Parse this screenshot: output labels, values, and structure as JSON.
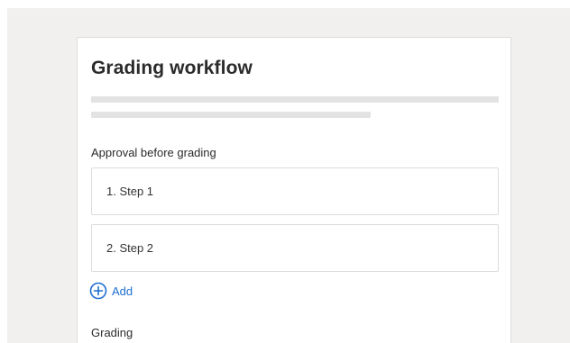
{
  "page": {
    "title": "Grading workflow"
  },
  "approval": {
    "label": "Approval before grading",
    "steps": [
      {
        "label": "1. Step 1"
      },
      {
        "label": "2. Step 2"
      }
    ],
    "add_label": "Add"
  },
  "grading": {
    "label": "Grading"
  },
  "icons": {
    "add": "plus-circle-icon"
  },
  "colors": {
    "link": "#1f6fd1",
    "background": "#f1f0ef"
  }
}
